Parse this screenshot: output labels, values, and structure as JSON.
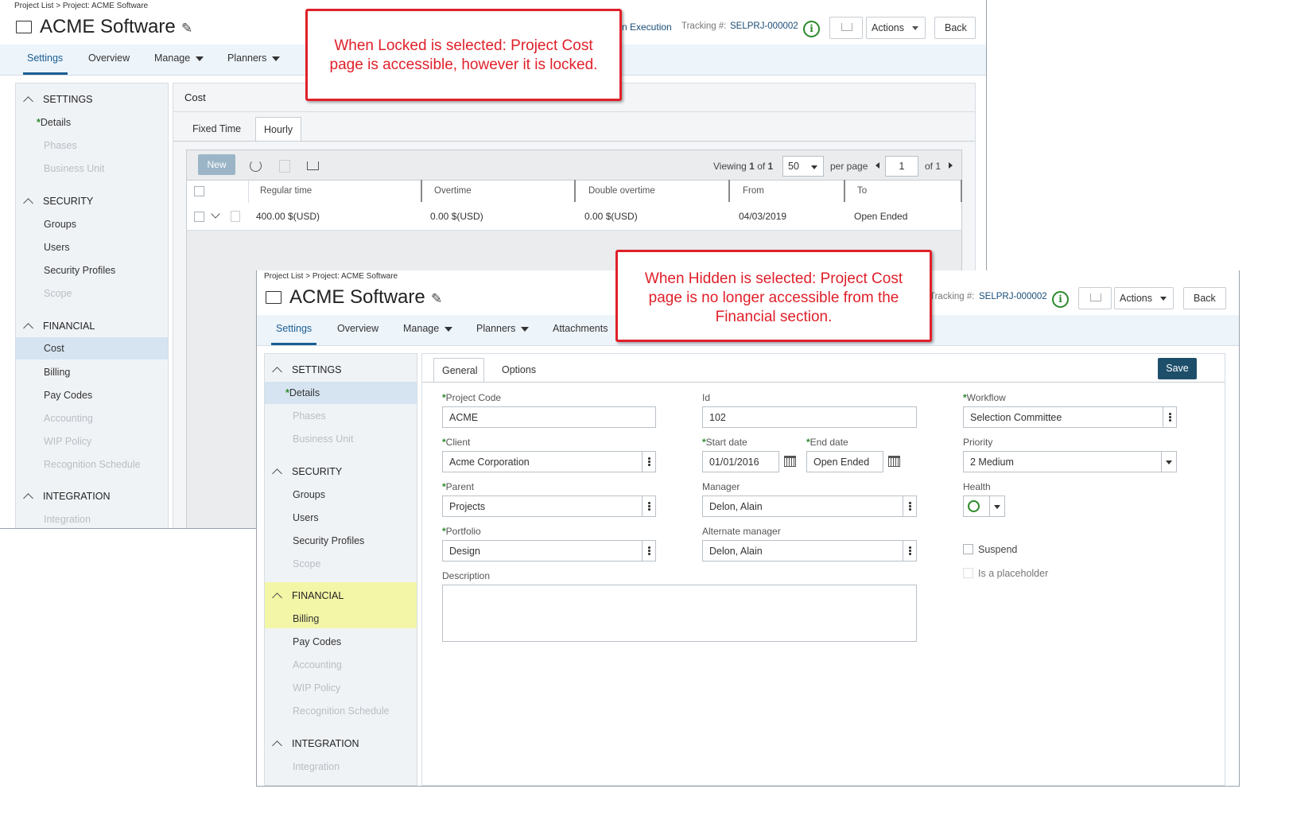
{
  "back_window": {
    "breadcrumb": "Project List > Project: ACME Software",
    "title": "ACME Software",
    "status_fragment": "n Execution",
    "tracking_label": "Tracking #:",
    "tracking_value": "SELPRJ-000002",
    "actions_label": "Actions",
    "back_label": "Back",
    "nav": [
      "Settings",
      "Overview",
      "Manage",
      "Planners"
    ],
    "sidebar": {
      "settings_header": "SETTINGS",
      "settings_items": [
        "Details",
        "Phases",
        "Business Unit"
      ],
      "security_header": "SECURITY",
      "security_items": [
        "Groups",
        "Users",
        "Security Profiles",
        "Scope"
      ],
      "financial_header": "FINANCIAL",
      "financial_items": [
        "Cost",
        "Billing",
        "Pay Codes",
        "Accounting",
        "WIP Policy",
        "Recognition Schedule"
      ],
      "integration_header": "INTEGRATION",
      "integration_items": [
        "Integration"
      ]
    },
    "content": {
      "section_title": "Cost",
      "tabs": [
        "Fixed Time",
        "Hourly"
      ],
      "new_label": "New",
      "viewing_prefix": "Viewing",
      "viewing_range": "1",
      "viewing_of": "of",
      "viewing_total": "1",
      "page_size": "50",
      "per_page_label": "per page",
      "page_number": "1",
      "page_of": "of 1",
      "columns": [
        "Regular time",
        "Overtime",
        "Double overtime",
        "From",
        "To"
      ],
      "row": [
        "400.00 $(USD)",
        "0.00 $(USD)",
        "0.00 $(USD)",
        "04/03/2019",
        "Open Ended"
      ]
    }
  },
  "front_window": {
    "breadcrumb": "Project List > Project: ACME Software",
    "title": "ACME Software",
    "tracking_label": "Tracking #:",
    "tracking_value": "SELPRJ-000002",
    "actions_label": "Actions",
    "back_label": "Back",
    "nav": [
      "Settings",
      "Overview",
      "Manage",
      "Planners",
      "Attachments"
    ],
    "sidebar": {
      "settings_header": "SETTINGS",
      "settings_items": [
        "Details",
        "Phases",
        "Business Unit"
      ],
      "security_header": "SECURITY",
      "security_items": [
        "Groups",
        "Users",
        "Security Profiles",
        "Scope"
      ],
      "financial_header": "FINANCIAL",
      "financial_items": [
        "Billing",
        "Pay Codes",
        "Accounting",
        "WIP Policy",
        "Recognition Schedule"
      ],
      "integration_header": "INTEGRATION",
      "integration_items": [
        "Integration"
      ]
    },
    "tabs": [
      "General",
      "Options"
    ],
    "save_label": "Save",
    "form": {
      "project_code_label": "Project Code",
      "project_code": "ACME",
      "id_label": "Id",
      "id": "102",
      "workflow_label": "Workflow",
      "workflow": "Selection Committee",
      "client_label": "Client",
      "client": "Acme Corporation",
      "start_date_label": "Start date",
      "start_date": "01/01/2016",
      "end_date_label": "End date",
      "end_date": "Open Ended",
      "priority_label": "Priority",
      "priority": "2 Medium",
      "parent_label": "Parent",
      "parent": "Projects",
      "manager_label": "Manager",
      "manager": "Delon, Alain",
      "health_label": "Health",
      "portfolio_label": "Portfolio",
      "portfolio": "Design",
      "alt_manager_label": "Alternate manager",
      "alt_manager": "Delon, Alain",
      "suspend_label": "Suspend",
      "placeholder_label": "Is a placeholder",
      "description_label": "Description",
      "description": ""
    }
  },
  "annotations": {
    "locked": "When Locked is selected: Project Cost page is accessible, however it is locked.",
    "hidden": "When Hidden is selected: Project Cost page is no longer accessible from the Financial section."
  },
  "colors": {
    "accent": "#1a5e94",
    "annotation_red": "#e0202a",
    "highlight_yellow": "#f3f6a6",
    "selected_blue": "#d6e4f1",
    "save_button": "#1d4f6b",
    "required_green": "#2a8a2a"
  }
}
